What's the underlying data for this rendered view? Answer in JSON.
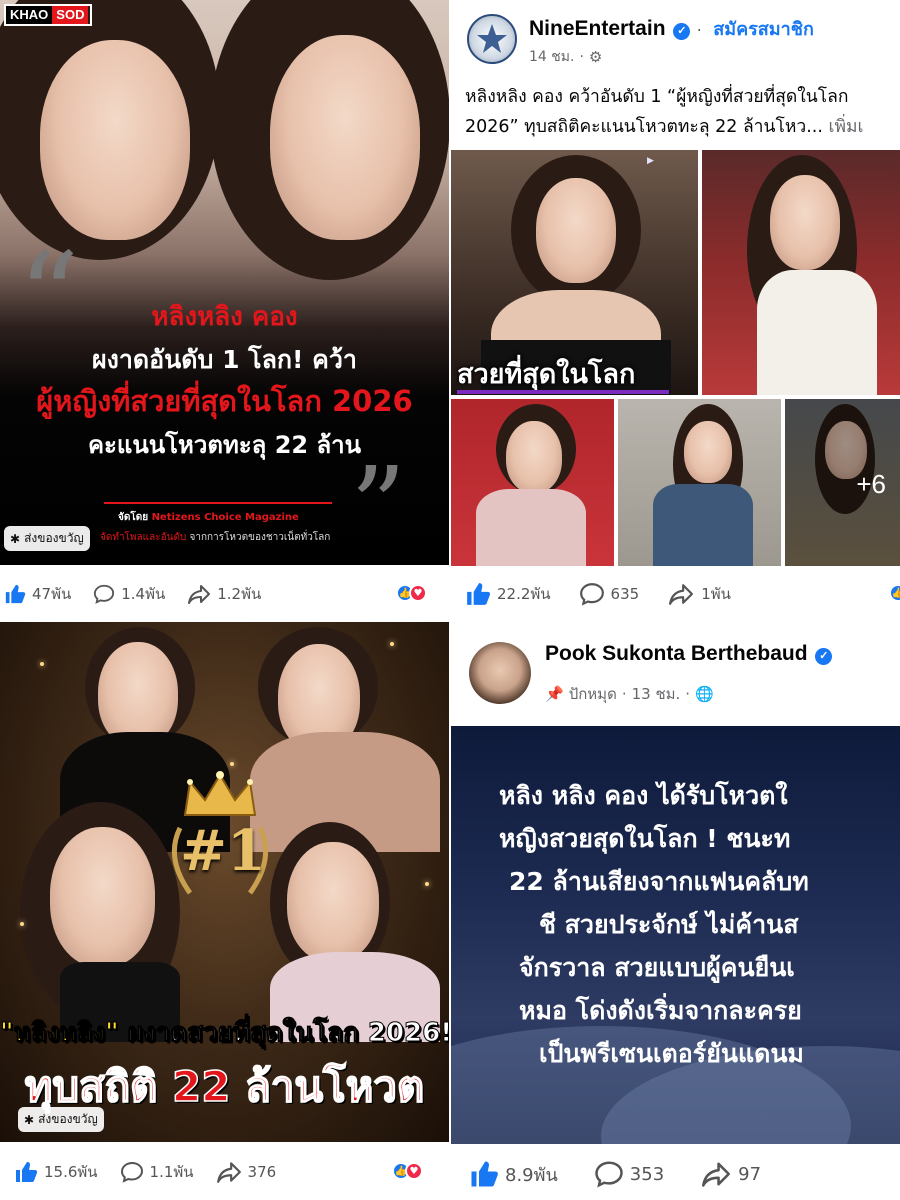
{
  "panels": {
    "khaosod": {
      "logo": {
        "left": "KHAO",
        "right": "SOD"
      },
      "headline": {
        "name": "หลิงหลิง คอง",
        "line2": "ผงาดอันดับ 1 โลก! คว้า",
        "line3": "ผู้หญิงที่สวยที่สุดในโลก 2026",
        "line4": "คะแนนโหวตทะลุ 22 ล้าน"
      },
      "organizer_label": "จัดโดย",
      "organizer_name": "Netizens Choice Magazine",
      "subline_red": "จัดทำโพลและอันดับ",
      "subline_rest": "จากการโหวตของชาวเน็ตทั่วโลก",
      "gift_label": "ส่งของขวัญ",
      "likes": "47พัน",
      "comments": "1.4พัน",
      "shares": "1.2พัน"
    },
    "nine_entertain": {
      "page_name": "NineEntertain",
      "follow_label": "สมัครสมาชิก",
      "time": "14 ชม.",
      "post_line1": "หลิงหลิง คอง  คว้าอันดับ 1 “ผู้หญิงที่สวยที่สุดในโลก",
      "post_line2": "2026” ทุบสถิติคะแนนโหวตทะลุ 22 ล้านโหว...",
      "see_more": "เพิ่มเ",
      "photo_caption": "สวยที่สุดในโลก",
      "more_photos": "+6",
      "likes": "22.2พัน",
      "comments": "635",
      "shares": "1พัน"
    },
    "poster": {
      "rank": "#1",
      "headline_quoted": "\"หลิงหลิง\"",
      "headline_rest": " ผงาดสวยที่สุดในโลก 2026!",
      "headline_big": "ทุบสถิติ 22 ล้านโหวต",
      "gift_label": "ส่งของขวัญ",
      "likes": "15.6พัน",
      "comments": "1.1พัน",
      "shares": "376"
    },
    "pook": {
      "author": "Pook Sukonta Berthebaud",
      "pinned_label": "ปักหมุด",
      "time": "13 ชม.",
      "body_lines": [
        "หลิง หลิง คอง ได้รับโหวตใ",
        "หญิงสวยสุดในโลก ! ชนะท",
        "22 ล้านเสียงจากแฟนคลับท",
        "ชี สวยประจักษ์ ไม่ค้านส",
        "จักรวาล สวยแบบผู้คนยืนเ",
        "หมอ โด่งดังเริ่มจากละครย",
        "เป็นพรีเซนเตอร์ยันแดนม"
      ],
      "likes": "8.9พัน",
      "comments": "353",
      "shares": "97"
    }
  },
  "colors": {
    "facebook_blue": "#1877f2",
    "khaosod_red": "#e3161b",
    "love_red": "#f02849",
    "text_gray": "#65676b"
  }
}
